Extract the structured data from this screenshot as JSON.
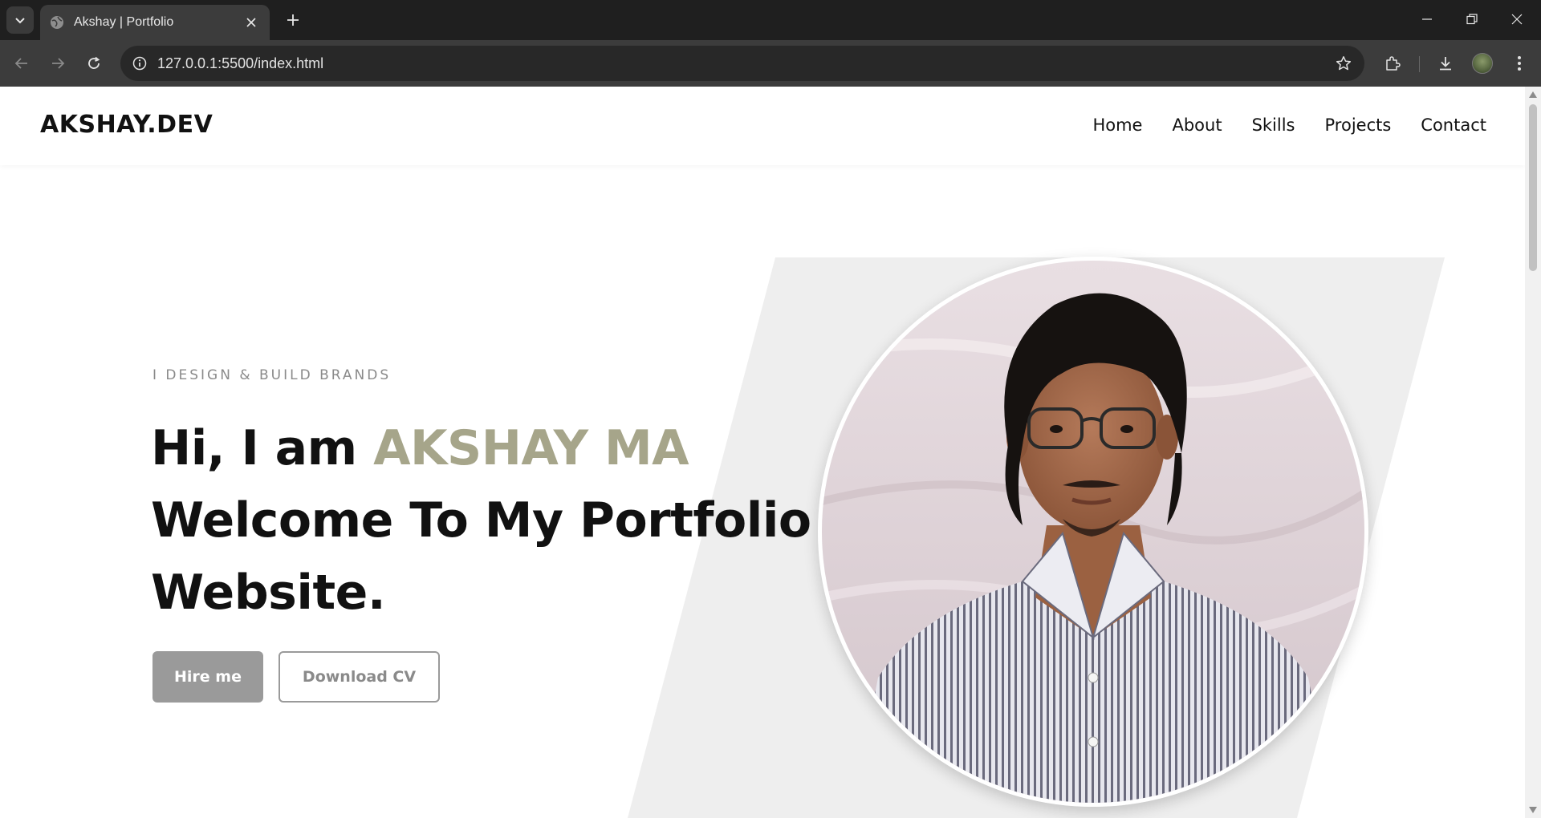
{
  "browser": {
    "tab_title": "Akshay | Portfolio",
    "url": "127.0.0.1:5500/index.html"
  },
  "site": {
    "logo": "AKSHAY.DEV",
    "nav": [
      "Home",
      "About",
      "Skills",
      "Projects",
      "Contact"
    ]
  },
  "hero": {
    "tagline": "I DESIGN & BUILD BRANDS",
    "greeting": "Hi, I am ",
    "name": "AKSHAY MA",
    "line2": "Welcome To My Portfolio",
    "line3": "Website.",
    "hire_label": "Hire me",
    "cv_label": "Download CV"
  },
  "colors": {
    "accent": "#a6a58a",
    "button_gray": "#9a9a9a",
    "shape_bg": "#eeeeee",
    "chrome_dark": "#1f1f1f",
    "chrome_toolbar": "#3c3c3c"
  }
}
